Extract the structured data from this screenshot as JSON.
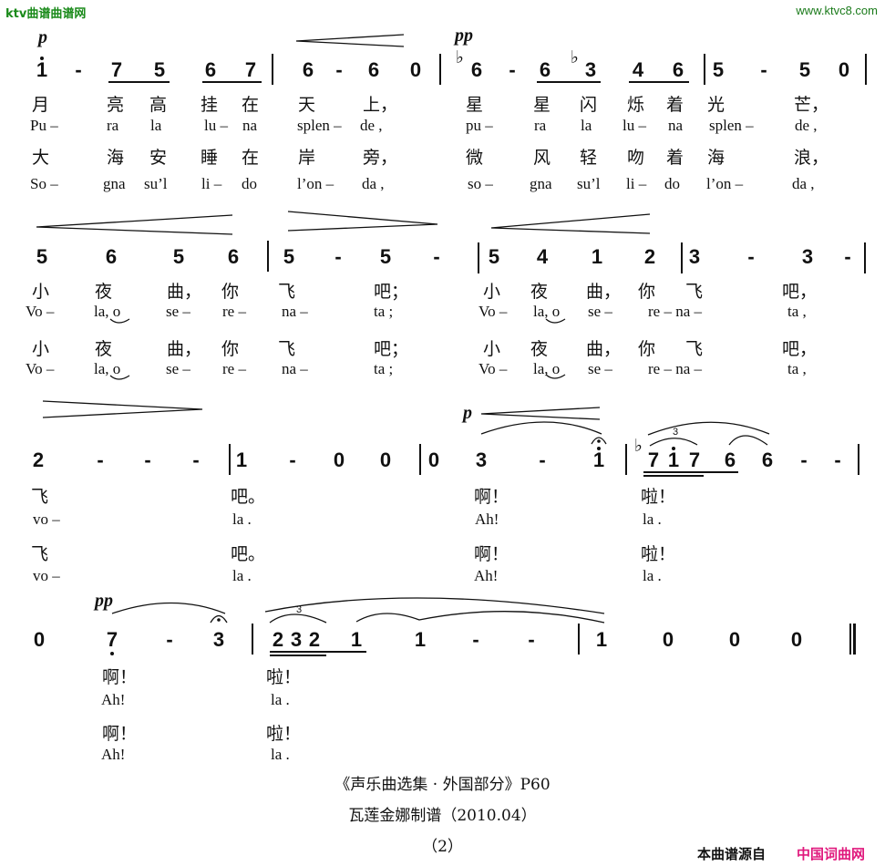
{
  "watermarks": {
    "top_left": "ktv曲谱曲谱网",
    "top_right": "www.ktvc8.com",
    "source_label": "本曲谱源自",
    "source_site": "中国词曲网",
    "source_site_color": "#e0197d"
  },
  "dynamics": {
    "row1_p": "p",
    "row1_pp": "pp",
    "row3_p": "p",
    "row4_pp": "pp"
  },
  "rows": [
    {
      "notes": [
        "1",
        "-",
        "7",
        "5",
        "6",
        "7",
        "6",
        "-",
        "6",
        "0",
        "6",
        "-",
        "6",
        "3",
        "4",
        "6",
        "5",
        "-",
        "5",
        "0"
      ],
      "accidentals": {
        "flat_a": "♭",
        "flat_b": "♭"
      },
      "lyrics": {
        "cn1": [
          "月",
          "亮",
          "高",
          "挂",
          "在",
          "天",
          "上，",
          "星",
          "星",
          "闪",
          "烁",
          "着",
          "光",
          "芒，"
        ],
        "en1": [
          "Pu –",
          "ra",
          "la",
          "lu –",
          "na",
          "splen –",
          "de ,",
          "pu –",
          "ra",
          "la",
          "lu –",
          "na",
          "splen –",
          "de ,"
        ],
        "cn2": [
          "大",
          "海",
          "安",
          "睡",
          "在",
          "岸",
          "旁，",
          "微",
          "风",
          "轻",
          "吻",
          "着",
          "海",
          "浪，"
        ],
        "en2": [
          "So –",
          "gna",
          "su’l",
          "li –",
          "do",
          "l’on –",
          "da ,",
          "so –",
          "gna",
          "su’l",
          "li –",
          "do",
          "l’on –",
          "da ,"
        ]
      }
    },
    {
      "notes": [
        "5",
        "6",
        "5",
        "6",
        "5",
        "-",
        "5",
        "-",
        "5",
        "4",
        "1",
        "2",
        "3",
        "-",
        "3",
        "-"
      ],
      "lyrics": {
        "cn1": [
          "小",
          "夜",
          "曲，",
          "你",
          "飞",
          "吧；",
          "小",
          "夜",
          "曲，",
          "你",
          "飞",
          "吧，"
        ],
        "en1": [
          "Vo –",
          "la, o",
          "se –",
          "re –",
          "na –",
          "ta ;",
          "Vo –",
          "la, o",
          "se –",
          "re – na –",
          "ta ,"
        ],
        "cn2": [
          "小",
          "夜",
          "曲，",
          "你",
          "飞",
          "吧；",
          "小",
          "夜",
          "曲，",
          "你",
          "飞",
          "吧，"
        ],
        "en2": [
          "Vo –",
          "la, o",
          "se –",
          "re –",
          "na –",
          "ta ;",
          "Vo –",
          "la, o",
          "se –",
          "re – na –",
          "ta ,"
        ]
      }
    },
    {
      "notes": [
        "2",
        "-",
        "-",
        "-",
        "1",
        "-",
        "0",
        "0",
        "0",
        "3",
        "-",
        "1",
        "7",
        "1",
        "7",
        "6",
        "6",
        "-",
        "-"
      ],
      "tuplet": "3",
      "lyrics": {
        "cn1": [
          "飞",
          "吧。",
          "啊！",
          "啦！"
        ],
        "en1": [
          "vo –",
          "la .",
          "Ah!",
          "la ."
        ],
        "cn2": [
          "飞",
          "吧。",
          "啊！",
          "啦！"
        ],
        "en2": [
          "vo –",
          "la .",
          "Ah!",
          "la ."
        ]
      }
    },
    {
      "notes": [
        "0",
        "7",
        "-",
        "3",
        "2",
        "3",
        "2",
        "1",
        "1",
        "-",
        "-",
        "1",
        "0",
        "0",
        "0"
      ],
      "tuplet": "3",
      "lyrics": {
        "cn1": [
          "啊！",
          "啦！"
        ],
        "en1": [
          "Ah!",
          "la ."
        ],
        "cn2": [
          "啊！",
          "啦！"
        ],
        "en2": [
          "Ah!",
          "la ."
        ]
      }
    }
  ],
  "footer": {
    "source": "《声乐曲选集 · 外国部分》P60",
    "arranger": "瓦莲金娜制谱（2010.04）",
    "page": "（2）"
  }
}
